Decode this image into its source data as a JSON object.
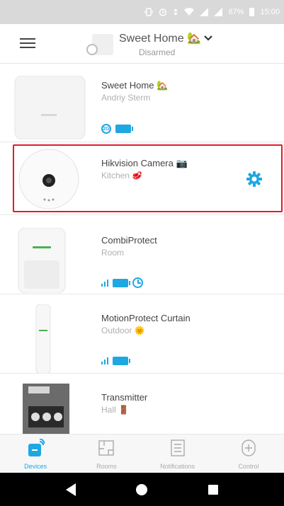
{
  "status_bar": {
    "battery": "87%",
    "time": "15:00",
    "icons": [
      "vibrate-icon",
      "alarm-icon",
      "data-arrows-icon",
      "wifi-icon",
      "signal-sim1-icon",
      "signal-sim2-icon"
    ]
  },
  "header": {
    "hub_name": "Sweet Home 🏡",
    "hub_state": "Disarmed",
    "menu_icon": "hamburger-icon",
    "dropdown_icon": "chevron-down-icon"
  },
  "devices": [
    {
      "name": "Sweet Home 🏡",
      "room": "Andriy Sterm",
      "image": "hub-device",
      "status_icons": [
        "sim-badge-icon",
        "battery-icon"
      ],
      "badge_text": "2G"
    },
    {
      "name": "Hikvision Camera 📷",
      "room": "Kitchen 🥩",
      "image": "camera-device",
      "selected": true,
      "action_icon": "gear-icon"
    },
    {
      "name": "CombiProtect",
      "room": "Room",
      "image": "motion-detector-device",
      "status_icons": [
        "signal-icon",
        "battery-icon",
        "clock-icon"
      ]
    },
    {
      "name": "MotionProtect Curtain",
      "room": "Outdoor 🌞",
      "image": "curtain-detector-device",
      "status_icons": [
        "signal-icon",
        "battery-icon"
      ]
    },
    {
      "name": "Transmitter",
      "room": "Hall 🚪",
      "image": "transmitter-module-device",
      "status_icons": []
    }
  ],
  "bottom_nav": [
    {
      "label": "Devices",
      "icon": "devices-icon",
      "active": true
    },
    {
      "label": "Rooms",
      "icon": "rooms-icon",
      "active": false
    },
    {
      "label": "Notifications",
      "icon": "notifications-icon",
      "active": false
    },
    {
      "label": "Control",
      "icon": "control-icon",
      "active": false
    }
  ],
  "colors": {
    "accent": "#1ea7e1",
    "selection_border": "#e31b2c",
    "status_bar": "#d9d9d9"
  }
}
